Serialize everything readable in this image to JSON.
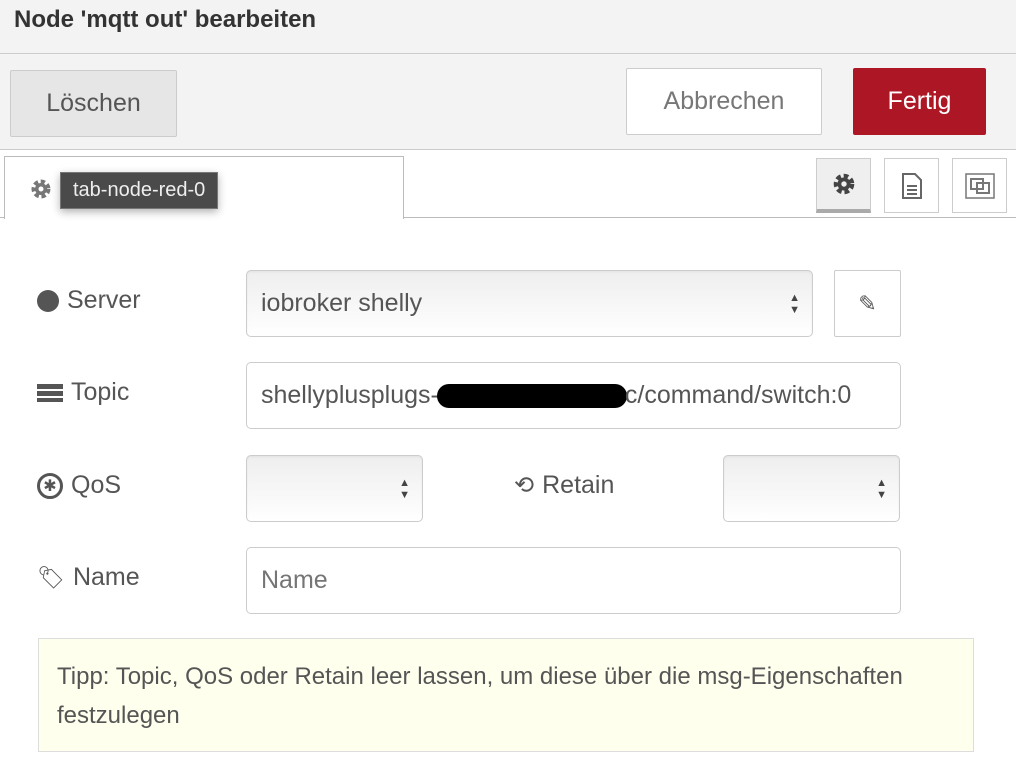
{
  "title": "Node 'mqtt out' bearbeiten",
  "toolbar": {
    "delete": "Löschen",
    "cancel": "Abbrechen",
    "done": "Fertig",
    "done_color": "#ad1625"
  },
  "tab": {
    "tooltip": "tab-node-red-0",
    "icon": "gear-icon"
  },
  "tab_buttons": [
    "gear-icon",
    "document-icon",
    "frame-icon"
  ],
  "form": {
    "server": {
      "label": "Server",
      "value": "iobroker shelly"
    },
    "topic": {
      "label": "Topic",
      "prefix": "shellyplusplugs-",
      "suffix": "c/command/switch:0"
    },
    "qos": {
      "label": "QoS",
      "value": ""
    },
    "retain": {
      "label": "Retain",
      "value": ""
    },
    "name": {
      "label": "Name",
      "placeholder": "Name",
      "value": ""
    }
  },
  "tip": "Tipp: Topic, QoS oder Retain leer lassen, um diese über die msg-Eigenschaften festzulegen"
}
